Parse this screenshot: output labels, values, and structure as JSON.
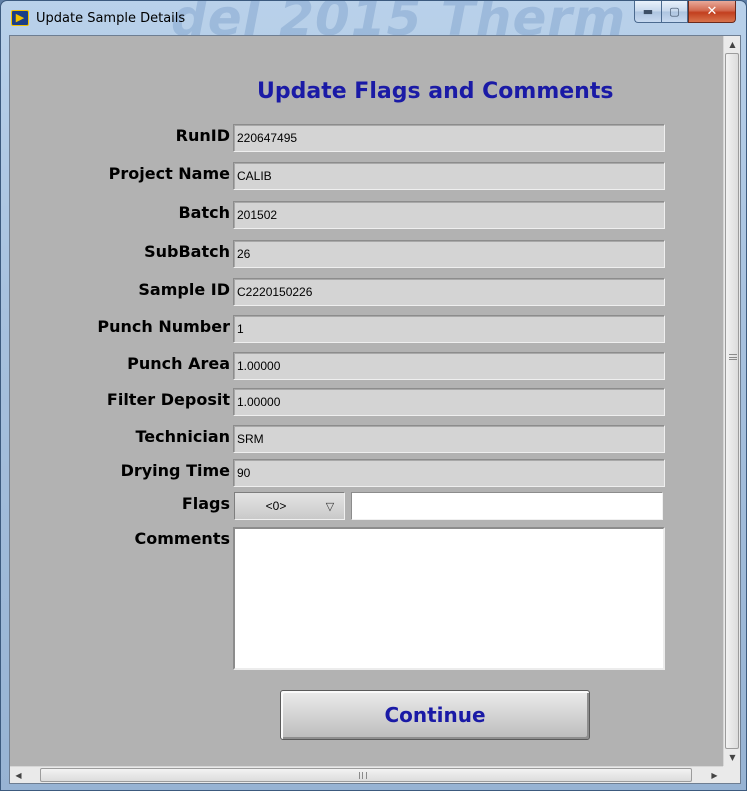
{
  "window": {
    "title": "Update Sample Details",
    "background_title_text": "del 2015 Therm",
    "app_icon_glyph": "▶",
    "controls": {
      "minimize": "▬",
      "maximize": "▢",
      "close": "✕"
    }
  },
  "heading": "Update Flags and Comments",
  "fields": [
    {
      "label": "RunID",
      "value": "220647495"
    },
    {
      "label": "Project Name",
      "value": "CALIB"
    },
    {
      "label": "Batch",
      "value": "201502"
    },
    {
      "label": "SubBatch",
      "value": "26"
    },
    {
      "label": "Sample ID",
      "value": "C2220150226"
    },
    {
      "label": "Punch Number",
      "value": "1"
    },
    {
      "label": "Punch Area",
      "value": "1.00000"
    },
    {
      "label": "Filter Deposit",
      "value": "1.00000"
    },
    {
      "label": "Technician",
      "value": "SRM"
    },
    {
      "label": "Drying Time",
      "value": "90"
    }
  ],
  "flags": {
    "label": "Flags",
    "selected": "<0>",
    "arrow": "▽",
    "text": ""
  },
  "comments": {
    "label": "Comments",
    "value": ""
  },
  "continue_label": "Continue",
  "scrollbars": {
    "up": "▲",
    "down": "▼",
    "left": "◀",
    "right": "▶"
  },
  "colors": {
    "accent": "#1a1aa6",
    "panel": "#b2b2b2",
    "field_bg": "#d4d4d4"
  }
}
